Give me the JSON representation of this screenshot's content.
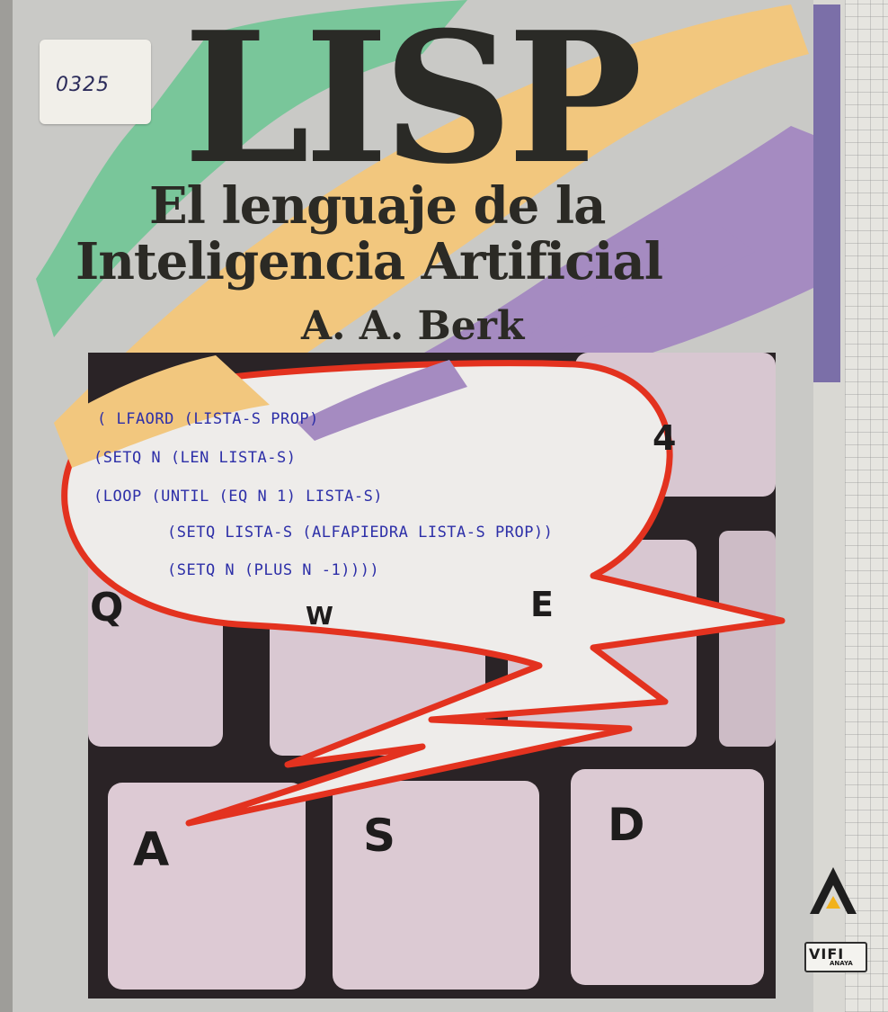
{
  "cover": {
    "sticker_number": "0325",
    "title": "LISP",
    "subtitle_line1": "El lenguaje de la",
    "subtitle_line2": "Inteligencia Artificial",
    "author": "A. A. Berk"
  },
  "code_lines": [
    "(    LFAORD (LISTA-S PROP)",
    "(SETQ N (LEN LISTA-S)",
    "(LOOP (UNTIL (EQ N 1) LISTA-S)",
    "(SETQ LISTA-S (ALFAPIEDRA LISTA-S PROP))",
    "(SETQ N (PLUS N -1))))"
  ],
  "keys": {
    "key_a": "A",
    "key_s": "S",
    "key_d": "D",
    "key_q": "Q",
    "key_w": "W",
    "key_e": "E",
    "key_4": "4"
  },
  "publisher": {
    "series": "VIFI",
    "publisher_name": "ANAYA"
  },
  "colors": {
    "green_stripe": "#79c69a",
    "yellow_stripe": "#f2c77e",
    "purple_stripe": "#a58bc1",
    "bubble_outline": "#e3321f",
    "code_text": "#2d2fa8",
    "key_face": "#dcc9d2"
  }
}
